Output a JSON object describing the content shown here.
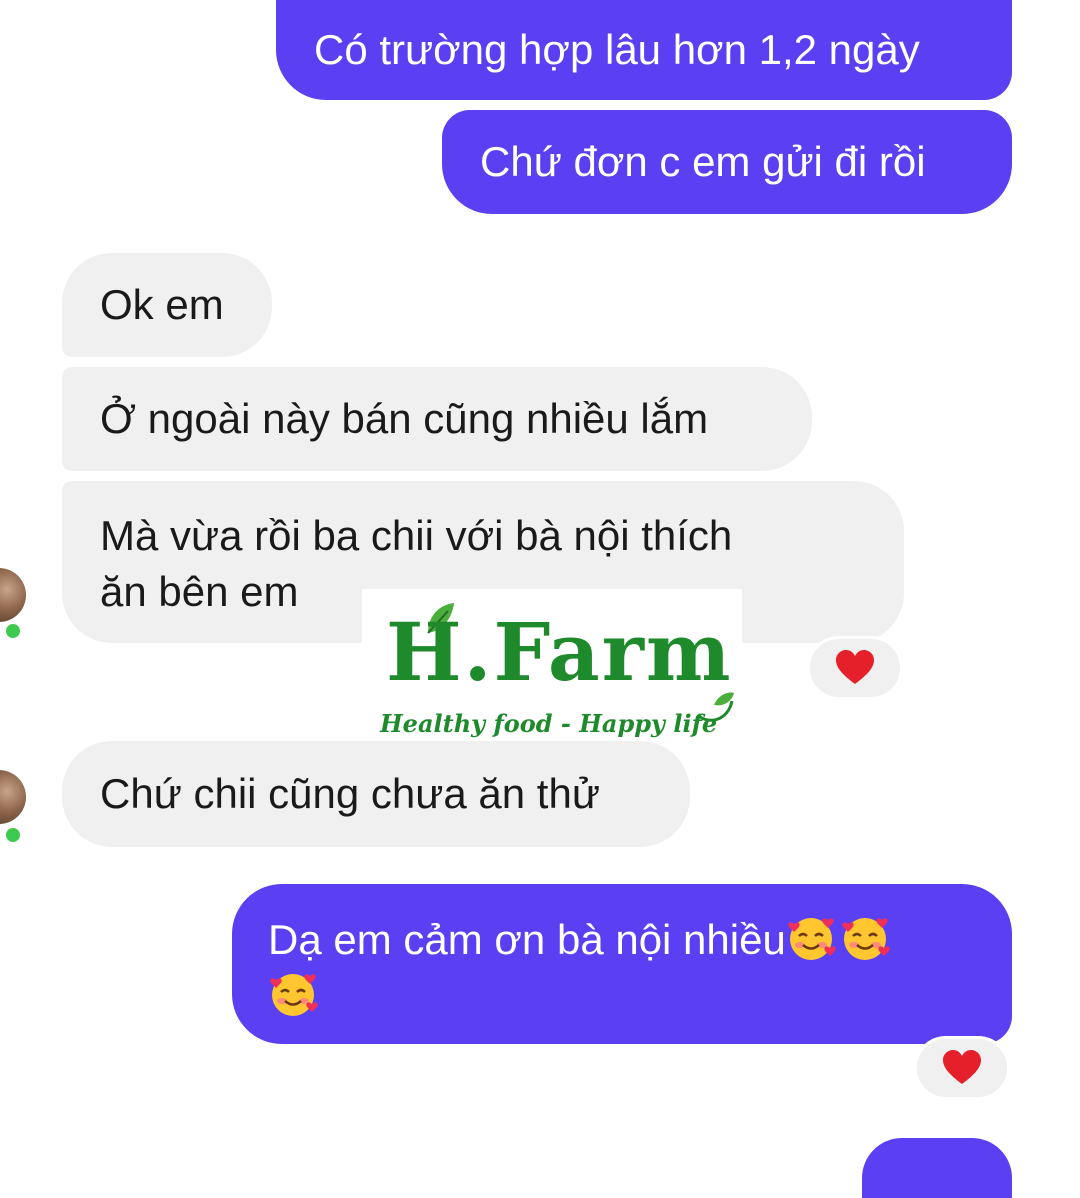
{
  "messages": [
    {
      "side": "out",
      "text": "Có trường hợp lâu hơn 1,2 ngày"
    },
    {
      "side": "out",
      "text": "Chứ đơn c em gửi đi rồi"
    },
    {
      "side": "in",
      "text": "Ok em"
    },
    {
      "side": "in",
      "text": "Ở ngoài này bán cũng nhiều lắm"
    },
    {
      "side": "in",
      "line1": "Mà vừa rồi ba chii với bà nội thích",
      "line2": "ăn bên em",
      "reaction": "red-heart"
    },
    {
      "side": "in",
      "text": "Chứ chii cũng chưa ăn thử"
    },
    {
      "side": "out",
      "text": "Dạ em cảm ơn bà nội nhiều",
      "emojis": [
        "smiling-face-with-hearts",
        "smiling-face-with-hearts",
        "smiling-face-with-hearts"
      ],
      "reaction": "red-heart"
    }
  ],
  "watermark": {
    "title": "H.Farm",
    "subtitle": "Healthy food - Happy life"
  },
  "colors": {
    "outgoing_bubble": "#5a3ff3",
    "incoming_bubble": "#f0f0f0",
    "online_status": "#3ec94f",
    "heart": "#e5202a",
    "brand_green": "#1f8a2b"
  }
}
